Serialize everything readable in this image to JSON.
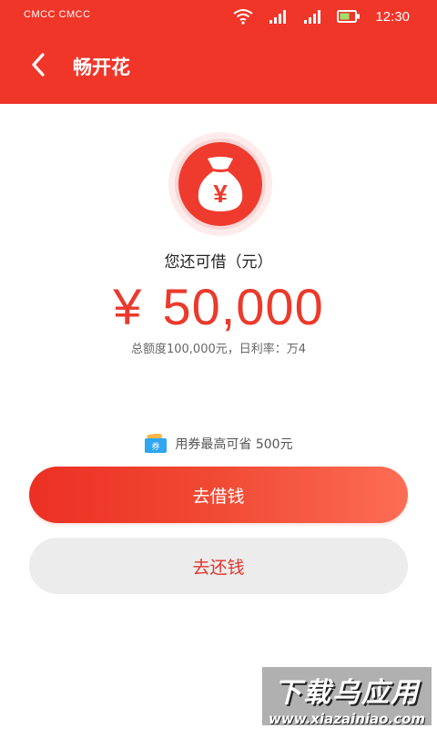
{
  "status_bar": {
    "carrier": "CMCC CMCC",
    "time": "12:30",
    "icons": [
      "wifi-icon",
      "signal-icon",
      "signal-icon",
      "battery-icon"
    ]
  },
  "nav": {
    "title": "畅开花",
    "back_icon": "chevron-left-icon"
  },
  "hero": {
    "badge_icon": "money-bag-icon",
    "badge_symbol": "¥",
    "label": "您还可借（元）",
    "currency": "¥",
    "amount": "50,000",
    "credit_info": "总额度100,000元，日利率：万4"
  },
  "coupon": {
    "icon": "coupon-icon",
    "icon_text": "券",
    "text": "用券最高可省 500元"
  },
  "buttons": {
    "borrow": "去借钱",
    "repay": "去还钱"
  },
  "watermark": {
    "title": "下载乌应用",
    "url": "www.xiazainiao.com"
  },
  "colors": {
    "primary": "#f03529",
    "amount": "#ea3a2c",
    "repay_bg": "#ececec"
  }
}
